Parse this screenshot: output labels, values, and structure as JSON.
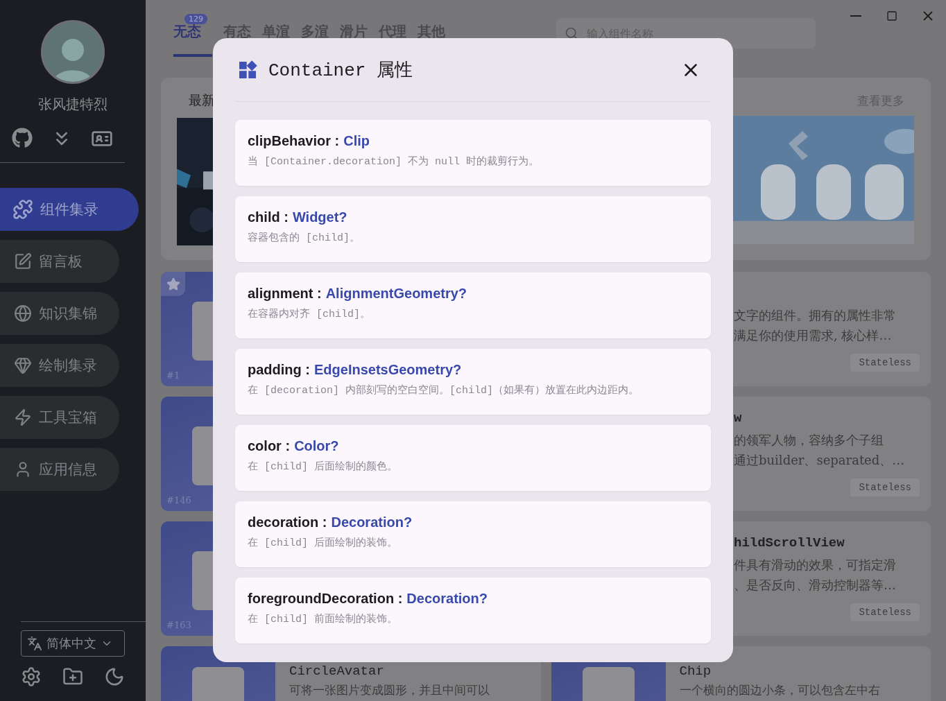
{
  "sidebar": {
    "user_name": "张风捷特烈",
    "nav": [
      {
        "label": "组件集录",
        "selected": true
      },
      {
        "label": "留言板",
        "selected": false
      },
      {
        "label": "知识集锦",
        "selected": false
      },
      {
        "label": "绘制集录",
        "selected": false
      },
      {
        "label": "工具宝箱",
        "selected": false
      },
      {
        "label": "应用信息",
        "selected": false
      }
    ],
    "language": "简体中文"
  },
  "tabs": [
    {
      "label": "无态",
      "selected": true,
      "badge": "129"
    },
    {
      "label": "有态",
      "selected": false
    },
    {
      "label": "单渲",
      "selected": false
    },
    {
      "label": "多渲",
      "selected": false
    },
    {
      "label": "滑片",
      "selected": false
    },
    {
      "label": "代理",
      "selected": false
    },
    {
      "label": "其他",
      "selected": false
    }
  ],
  "search": {
    "placeholder": "输入组件名称"
  },
  "featured": {
    "title": "最新",
    "more": "查看更多"
  },
  "tiles": [
    {
      "number": "#1",
      "starred": true
    },
    {
      "number": "#146",
      "starred": false
    },
    {
      "number": "#163",
      "starred": false
    }
  ],
  "cards": [
    {
      "lines": [
        "文字的组件。拥有的属性非常",
        "满足你的使用需求, 核心样…"
      ],
      "tag": "Stateless"
    },
    {
      "title": "w",
      "lines": [
        "的领军人物，容纳多个子组",
        "通过builder、separated、…"
      ],
      "tag": "Stateless"
    },
    {
      "title": "hildScrollView",
      "lines": [
        "件具有滑动的效果，可指定滑",
        "、是否反向、滑动控制器等…"
      ],
      "tag": "Stateless"
    }
  ],
  "bottom_cards": [
    {
      "title": "CircleAvatar",
      "text": "可将一张图片变成圆形，并且中间可以"
    },
    {
      "title": "Chip",
      "text": "一个横向的圆边小条，可以包含左中右"
    }
  ],
  "dialog": {
    "title": "Container 属性",
    "properties": [
      {
        "name": "clipBehavior :",
        "type": "Clip",
        "description": "当 [Container.decoration] 不为 null 时的裁剪行为。"
      },
      {
        "name": "child :",
        "type": "Widget?",
        "description": "容器包含的 [child]。"
      },
      {
        "name": "alignment :",
        "type": "AlignmentGeometry?",
        "description": "在容器内对齐 [child]。"
      },
      {
        "name": "padding :",
        "type": "EdgeInsetsGeometry?",
        "description": "在 [decoration] 内部刻写的空白空间。[child]（如果有）放置在此内边距内。"
      },
      {
        "name": "color :",
        "type": "Color?",
        "description": "在 [child] 后面绘制的颜色。"
      },
      {
        "name": "decoration :",
        "type": "Decoration?",
        "description": "在 [child] 后面绘制的装饰。"
      },
      {
        "name": "foregroundDecoration :",
        "type": "Decoration?",
        "description": "在 [child] 前面绘制的装饰。"
      }
    ]
  }
}
